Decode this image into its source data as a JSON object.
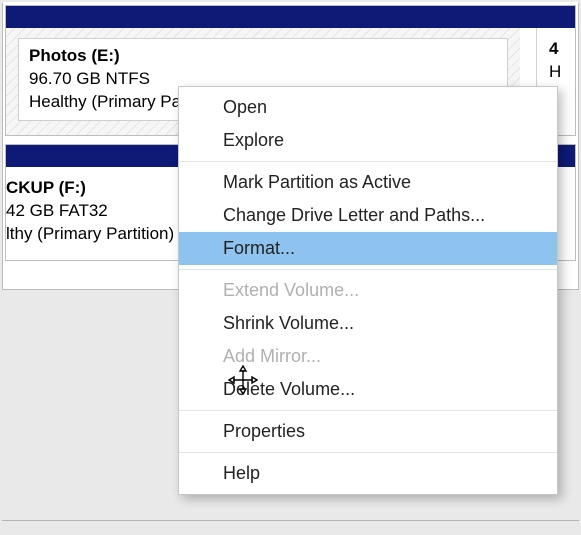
{
  "disks": [
    {
      "partitions": [
        {
          "title": "Photos  (E:)",
          "line2": "96.70 GB NTFS",
          "line3": "Healthy (Primary Partition)",
          "selected": true
        },
        {
          "title": "4",
          "line2": "",
          "line3": "H",
          "selected": false
        }
      ]
    },
    {
      "partitions": [
        {
          "title": "CKUP  (F:)",
          "line2": "42 GB FAT32",
          "line3": "lthy (Primary Partition)",
          "selected": false
        }
      ]
    }
  ],
  "context_menu": {
    "items": [
      {
        "label": "Open",
        "enabled": true,
        "highlight": false
      },
      {
        "label": "Explore",
        "enabled": true,
        "highlight": false
      },
      {
        "sep": true
      },
      {
        "label": "Mark Partition as Active",
        "enabled": true,
        "highlight": false
      },
      {
        "label": "Change Drive Letter and Paths...",
        "enabled": true,
        "highlight": false
      },
      {
        "label": "Format...",
        "enabled": true,
        "highlight": true
      },
      {
        "sep": true
      },
      {
        "label": "Extend Volume...",
        "enabled": false,
        "highlight": false
      },
      {
        "label": "Shrink Volume...",
        "enabled": true,
        "highlight": false
      },
      {
        "label": "Add Mirror...",
        "enabled": false,
        "highlight": false
      },
      {
        "label": "Delete Volume...",
        "enabled": true,
        "highlight": false
      },
      {
        "sep": true
      },
      {
        "label": "Properties",
        "enabled": true,
        "highlight": false
      },
      {
        "sep": true
      },
      {
        "label": "Help",
        "enabled": true,
        "highlight": false
      }
    ]
  }
}
